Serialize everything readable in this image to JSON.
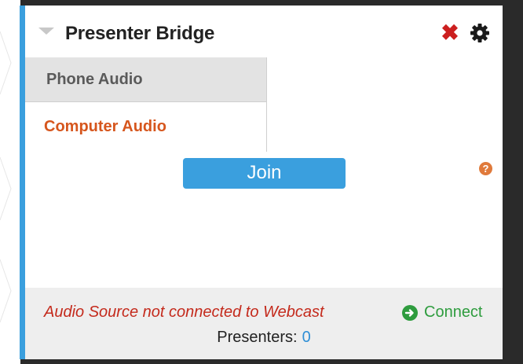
{
  "panel": {
    "title": "Presenter Bridge",
    "close_icon": "close-icon",
    "settings_icon": "gear-icon"
  },
  "tabs": [
    {
      "label": "Phone Audio"
    },
    {
      "label": "Computer Audio",
      "active": true
    }
  ],
  "join": {
    "label": "Join"
  },
  "help": {
    "icon": "question-icon",
    "glyph": "?"
  },
  "footer": {
    "status": "Audio Source not connected to Webcast",
    "connect_label": "Connect",
    "presenters_label": "Presenters:",
    "presenters_count": "0"
  },
  "colors": {
    "accent_blue": "#3a9fde",
    "active_tab": "#d6561d",
    "status_red": "#c42a1c",
    "connect_green": "#2e9c3e",
    "close_red": "#cc1f1f"
  }
}
